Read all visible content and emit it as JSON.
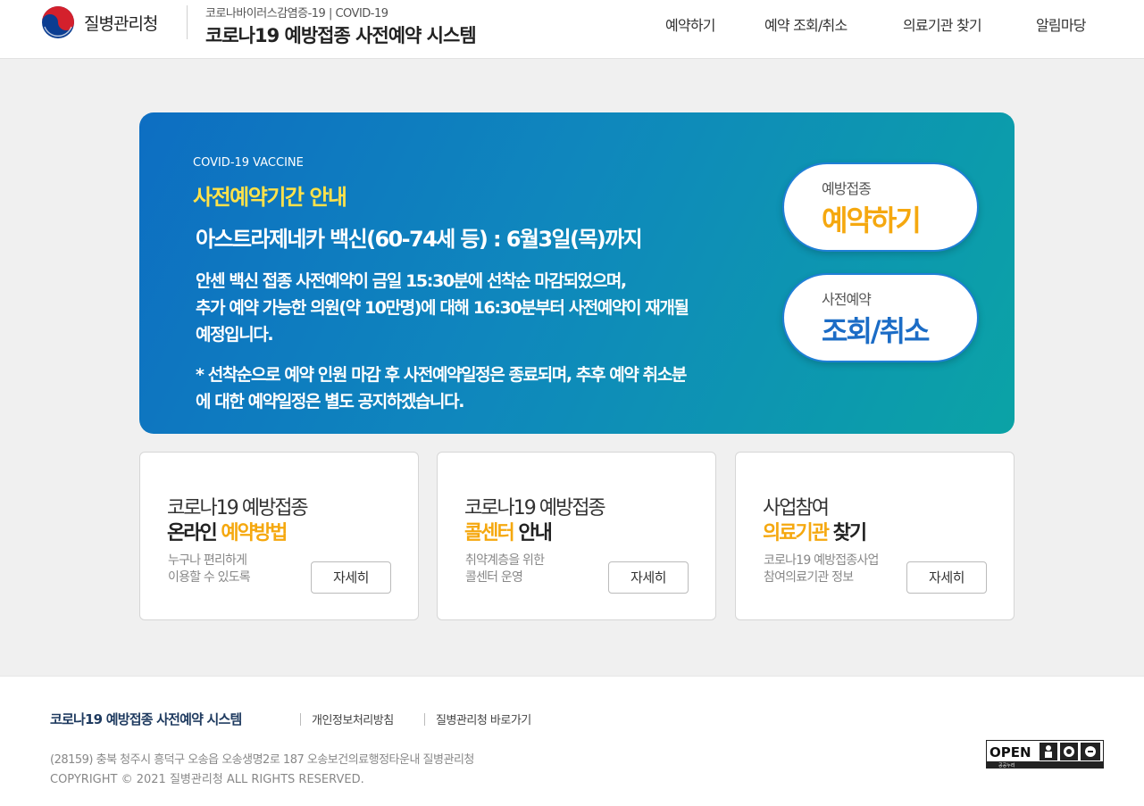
{
  "header": {
    "agency": "질병관리청",
    "subtitle": "코로나바이러스감염증-19 | COVID-19",
    "title": "코로나19 예방접종 사전예약 시스템",
    "nav": [
      "예약하기",
      "예약 조회/취소",
      "의료기관 찾기",
      "알림마당"
    ]
  },
  "banner": {
    "tag": "COVID-19 VACCINE",
    "heading": "사전예약기간 안내",
    "main": "아스트라제네카 백신(60-74세 등) : 6월3일(목)까지",
    "body": [
      "안센 백신 접종 사전예약이 금일 15:30분에 선착순 마감되었으며,",
      "추가 예약 가능한 의원(약 10만명)에 대해 16:30분부터 사전예약이 재개될",
      "예정입니다."
    ],
    "note": [
      "* 선착순으로 예약 인원 마감 후 사전예약일정은 종료되며, 추후 예약 취소분",
      "에 대한 예약일정은 별도 공지하겠습니다."
    ],
    "reserve_button": {
      "small": "예방접종",
      "big": "예약하기",
      "color": "#f5a80f"
    },
    "lookup_button": {
      "small": "사전예약",
      "big": "조회/취소",
      "color": "#1b6cc6"
    }
  },
  "cards": [
    {
      "line1": "코로나19 예방접종",
      "line2_a": "온라인 ",
      "line2_b": "예약방법",
      "desc": [
        "누구나 편리하게",
        "이용할 수 있도록"
      ],
      "button": "자세히"
    },
    {
      "line1": "코로나19 예방접종",
      "line2_a": "콜센터",
      "line2_b": " 안내",
      "desc": [
        "취약계층을 위한",
        "콜센터 운영"
      ],
      "button": "자세히"
    },
    {
      "line1": "사업참여",
      "line2_a": "의료기관",
      "line2_b": " 찾기",
      "desc": [
        "코로나19 예방접종사업",
        "참여의료기관 정보"
      ],
      "button": "자세히"
    }
  ],
  "footer": {
    "title": "코로나19 예방접종 사전예약 시스템",
    "links": [
      "개인정보처리방침",
      "질병관리청 바로가기"
    ],
    "address": "(28159) 충북 청주시 흥덕구 오송읍 오송생명2로 187 오송보건의료행정타운내 질병관리청",
    "copyright": "COPYRIGHT © 2021 질병관리청 ALL RIGHTS RESERVED.",
    "open_badge": "OPEN",
    "open_badge_sub": "공공누리"
  }
}
